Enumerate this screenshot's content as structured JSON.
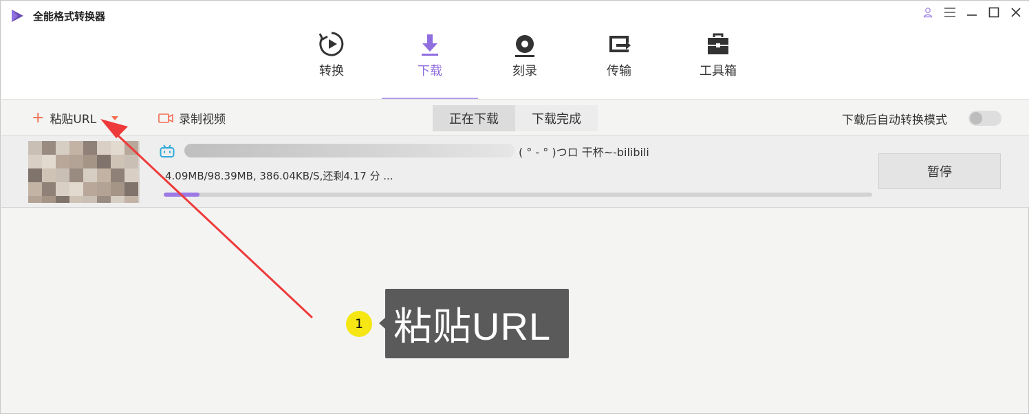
{
  "app": {
    "title": "全能格式转换器"
  },
  "window_controls": [
    "user-icon",
    "menu-icon",
    "minimize-icon",
    "maximize-icon",
    "close-icon"
  ],
  "nav": {
    "tabs": [
      {
        "label": "转换",
        "icon": "convert-icon"
      },
      {
        "label": "下载",
        "icon": "download-icon",
        "active": true
      },
      {
        "label": "刻录",
        "icon": "burn-disc-icon"
      },
      {
        "label": "传输",
        "icon": "transfer-icon"
      },
      {
        "label": "工具箱",
        "icon": "toolbox-icon"
      }
    ]
  },
  "toolbar": {
    "paste_label": "粘贴URL",
    "record_label": "录制视频",
    "segments": [
      "正在下载",
      "下载完成"
    ],
    "active_segment": "正在下载",
    "auto_convert_label": "下载后自动转换模式",
    "auto_convert_on": false
  },
  "download": {
    "title_suffix": "( ° - ° )つロ 干杯~-bilibili",
    "status": "4.09MB/98.39MB, 386.04KB/S,还剩4.17 分 ...",
    "progress": 0.05,
    "pause_label": "暂停"
  },
  "annotation": {
    "step": "1",
    "text": "粘贴URL"
  },
  "colors": {
    "accent": "#8f6ee0",
    "progress": "#9c79e4",
    "paste_plus": "#f26c4f",
    "arrow": "#ee3a3a",
    "badge": "#f5e614",
    "callout_bg": "#5a5a5a"
  }
}
